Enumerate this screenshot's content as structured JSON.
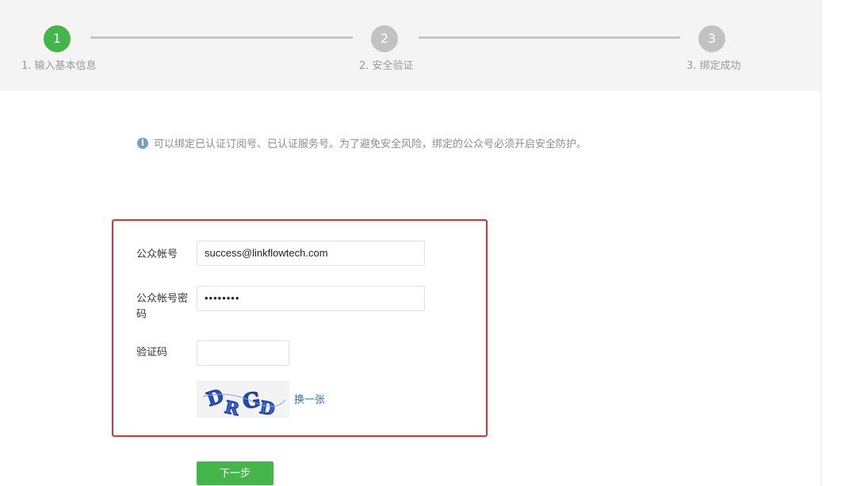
{
  "steps": [
    {
      "number": "1",
      "label": "1. 输入基本信息",
      "state": "active"
    },
    {
      "number": "2",
      "label": "2. 安全验证",
      "state": "pending"
    },
    {
      "number": "3",
      "label": "3. 绑定成功",
      "state": "pending"
    }
  ],
  "tip": {
    "icon": "info-icon",
    "text": "可以绑定已认证订阅号、已认证服务号。为了避免安全风险，绑定的公众号必须开启安全防护。"
  },
  "form": {
    "account_label": "公众帐号",
    "account_value": "success@linkflowtech.com",
    "password_label": "公众帐号密码",
    "password_value": "••••••••",
    "captcha_label": "验证码",
    "captcha_value": "",
    "refresh_label": "换一张"
  },
  "actions": {
    "next_label": "下一步"
  },
  "colors": {
    "primary_green": "#44b549",
    "pending_gray": "#c2c2c2",
    "highlight_red": "#e5302d",
    "link_blue": "#2b6fc2"
  }
}
